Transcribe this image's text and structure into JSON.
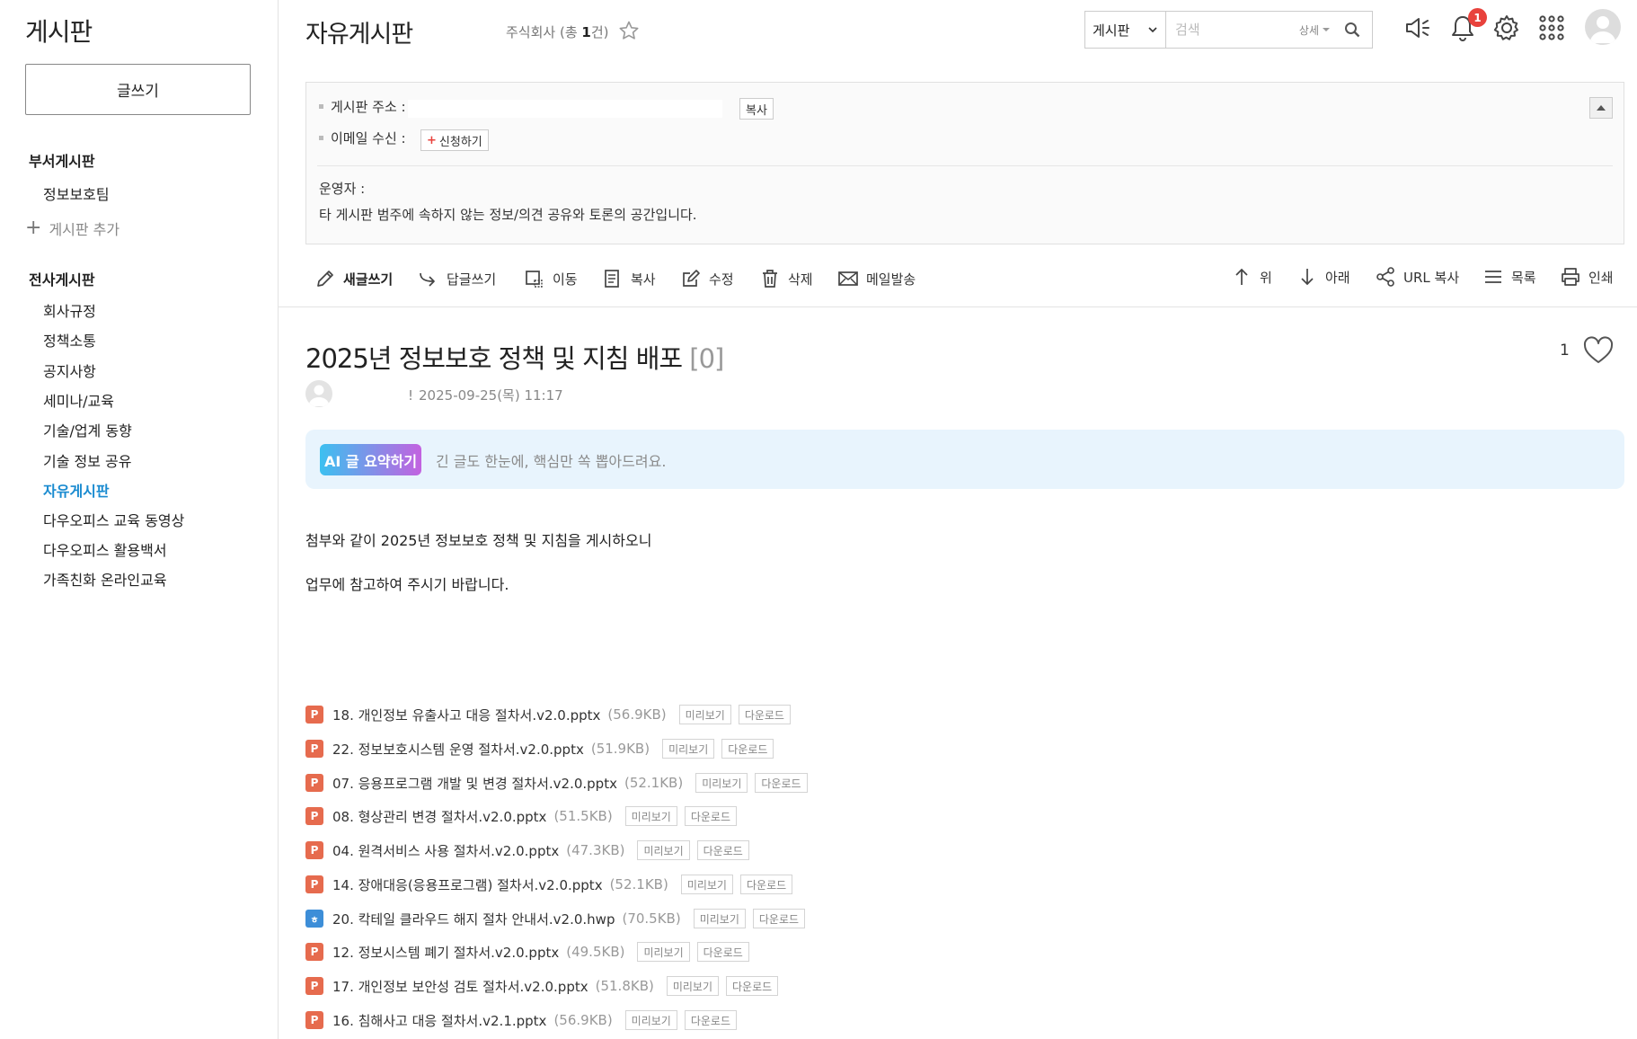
{
  "sidebar": {
    "title": "게시판",
    "write_label": "글쓰기",
    "dept_section": "부서게시판",
    "dept_items": [
      "정보보호팀"
    ],
    "add_board": "게시판 추가",
    "company_section": "전사게시판",
    "company_items": [
      {
        "label": "회사규정",
        "active": false
      },
      {
        "label": "정책소통",
        "active": false
      },
      {
        "label": "공지사항",
        "active": false
      },
      {
        "label": "세미나/교육",
        "active": false
      },
      {
        "label": "기술/업계 동향",
        "active": false
      },
      {
        "label": "기술 정보 공유",
        "active": false
      },
      {
        "label": "자유게시판",
        "active": true
      },
      {
        "label": "다우오피스 교육 동영상",
        "active": false
      },
      {
        "label": "다우오피스 활용백서",
        "active": false
      },
      {
        "label": "가족친화 온라인교육",
        "active": false
      }
    ]
  },
  "header": {
    "title": "자유게시판",
    "company_prefix": "주식회사 (총 ",
    "company_count": "1",
    "company_suffix": "건)",
    "search": {
      "scope": "게시판",
      "placeholder": "검색",
      "detail": "상세"
    },
    "notification_count": "1"
  },
  "info": {
    "address_label": "게시판 주소 :",
    "copy_label": "복사",
    "email_label": "이메일 수신 :",
    "subscribe_label": "신청하기",
    "operator_label": "운영자 :",
    "description": "타 게시판 범주에 속하지 않는 정보/의견 공유와 토론의 공간입니다."
  },
  "toolbar": {
    "new_post": "새글쓰기",
    "reply": "답글쓰기",
    "move": "이동",
    "copy": "복사",
    "edit": "수정",
    "delete": "삭제",
    "mail": "메일발송",
    "up": "위",
    "down": "아래",
    "url_copy": "URL 복사",
    "list": "목록",
    "print": "인쇄"
  },
  "post": {
    "title": "2025년 정보보호 정책 및 지침 배포",
    "comment_count": "[0]",
    "like_count": "1",
    "author_mark": "!",
    "date": "2025-09-25(목) 11:17",
    "ai_button": "AI 글 요약하기",
    "ai_text": "긴 글도 한눈에, 핵심만 쏙 뽑아드려요.",
    "body": [
      "첨부와 같이 2025년 정보보호 정책 및 지침을 게시하오니",
      "업무에 참고하여 주시기 바랍니다."
    ]
  },
  "attachments": {
    "preview_label": "미리보기",
    "download_label": "다운로드",
    "files": [
      {
        "type": "P",
        "name": "18. 개인정보 유출사고 대응 절차서.v2.0.pptx",
        "size": "(56.9KB)"
      },
      {
        "type": "P",
        "name": "22. 정보보호시스템 운영 절차서.v2.0.pptx",
        "size": "(51.9KB)"
      },
      {
        "type": "P",
        "name": "07. 응용프로그램 개발 및 변경 절차서.v2.0.pptx",
        "size": "(52.1KB)"
      },
      {
        "type": "P",
        "name": "08. 형상관리 변경 절차서.v2.0.pptx",
        "size": "(51.5KB)"
      },
      {
        "type": "P",
        "name": "04. 원격서비스 사용 절차서.v2.0.pptx",
        "size": "(47.3KB)"
      },
      {
        "type": "P",
        "name": "14. 장애대응(응용프로그램) 절차서.v2.0.pptx",
        "size": "(52.1KB)"
      },
      {
        "type": "ㅎ",
        "name": "20. 칵테일 클라우드 해지 절차 안내서.v2.0.hwp",
        "size": "(70.5KB)"
      },
      {
        "type": "P",
        "name": "12. 정보시스템 폐기 절차서.v2.0.pptx",
        "size": "(49.5KB)"
      },
      {
        "type": "P",
        "name": "17. 개인정보 보안성 검토 절차서.v2.0.pptx",
        "size": "(51.8KB)"
      },
      {
        "type": "P",
        "name": "16. 침해사고 대응 절차서.v2.1.pptx",
        "size": "(56.9KB)"
      }
    ]
  },
  "colors": {
    "accent": "#1a8bd0",
    "badge": "#e8423c",
    "ppt_icon": "#e66b4e",
    "hwp_icon": "#3d8ed8",
    "ai_box": "#e8f4fd"
  },
  "icons": {
    "star": "star-icon",
    "speaker": "speaker-icon",
    "bell": "bell-icon",
    "gear": "gear-icon",
    "apps": "apps-grid-icon",
    "heart": "heart-icon"
  }
}
